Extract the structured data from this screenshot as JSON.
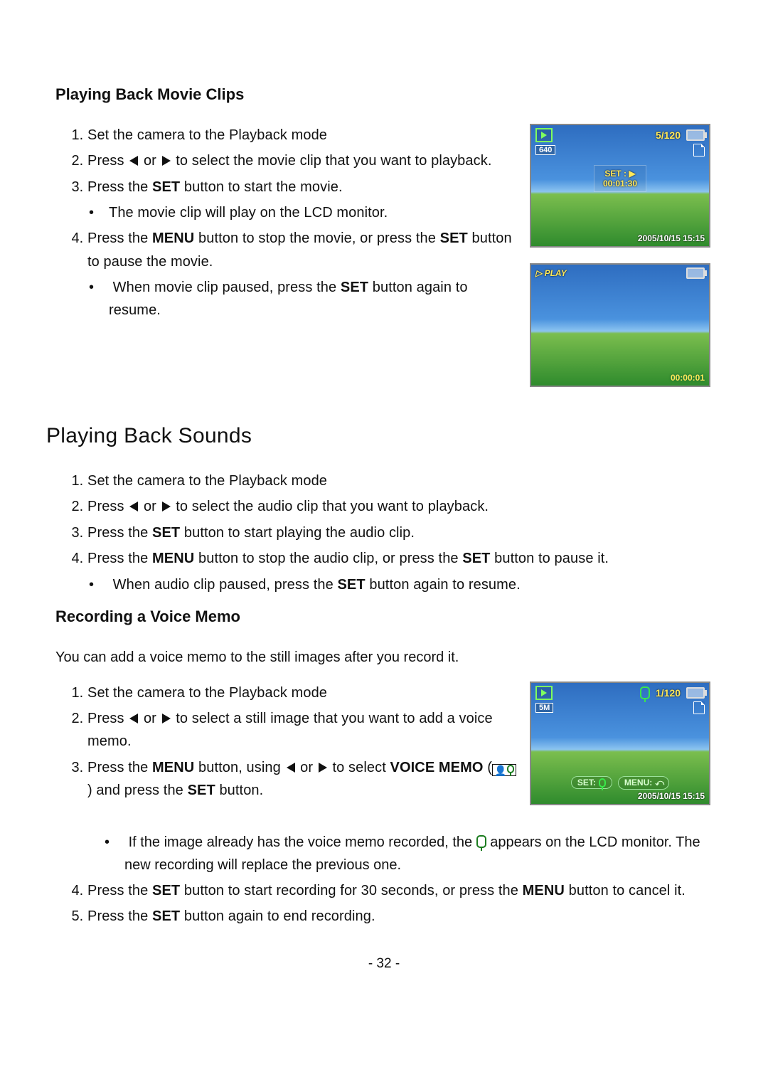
{
  "sections": {
    "movie": {
      "heading": "Playing Back Movie Clips",
      "steps": [
        "Set the camera to the Playback mode",
        {
          "pre": "Press ",
          "post": " to select the movie clip that you want to playback."
        },
        {
          "pre": "Press the ",
          "bold": "SET",
          "post": " button to start the movie."
        },
        {
          "pre": "Press the ",
          "bold1": "MENU",
          "mid": " button to stop the movie, or press the ",
          "bold2": "SET",
          "post": " button to pause the movie."
        }
      ],
      "sub3": "The movie clip will play on the LCD monitor.",
      "sub4": {
        "pre": "When movie clip paused, press the ",
        "bold": "SET",
        "post": " button again to resume."
      }
    },
    "sounds": {
      "heading": "Playing Back Sounds",
      "steps": [
        "Set the camera to the Playback mode",
        {
          "pre": "Press ",
          "post": " to select the audio clip that you want to playback."
        },
        {
          "pre": "Press the ",
          "bold": "SET",
          "post": " button to start playing the audio clip."
        },
        {
          "pre": "Press the ",
          "bold1": "MENU",
          "mid": " button to stop the audio clip, or press the ",
          "bold2": "SET",
          "post": " button to pause it."
        }
      ],
      "sub4": {
        "pre": "When audio clip paused, press the ",
        "bold": "SET",
        "post": " button again to resume."
      }
    },
    "memo": {
      "heading": "Recording a Voice Memo",
      "intro": "You can add a voice memo to the still images after you record it.",
      "steps": {
        "s1": "Set the camera to the Playback mode",
        "s2": {
          "pre": "Press ",
          "post": " to select a still image that you want to add a voice memo."
        },
        "s3": {
          "pre": "Press the ",
          "bold1": "MENU",
          "mid": " button, using ",
          "mid2": " to select ",
          "bold2": "VOICE MEMO",
          "paren_open": " (",
          "paren_close": ") and press the ",
          "bold3": "SET",
          "post": " button."
        },
        "s3sub": {
          "pre": "If the image already has the voice memo recorded, the ",
          "post": " appears on the LCD monitor.   The new recording will replace the previous one."
        },
        "s4": {
          "pre": "Press the ",
          "bold1": "SET",
          "mid": " button to start recording for 30 seconds, or press the ",
          "bold2": "MENU",
          "post": " button to cancel it."
        },
        "s5": {
          "pre": "Press the ",
          "bold": "SET",
          "post": " button again to end recording."
        }
      }
    }
  },
  "or_word": " or ",
  "lcd": {
    "movie_select": {
      "counter": "5/120",
      "res": "640",
      "set": "SET : ▶",
      "duration": "00:01:30",
      "timestamp": "2005/10/15  15:15"
    },
    "movie_play": {
      "label": "▷ PLAY",
      "elapsed": "00:00:01"
    },
    "memo": {
      "counter": "1/120",
      "res": "5M",
      "set": "SET:",
      "menu": "MENU:",
      "timestamp": "2005/10/15  15:15"
    }
  },
  "page_number": "- 32 -"
}
